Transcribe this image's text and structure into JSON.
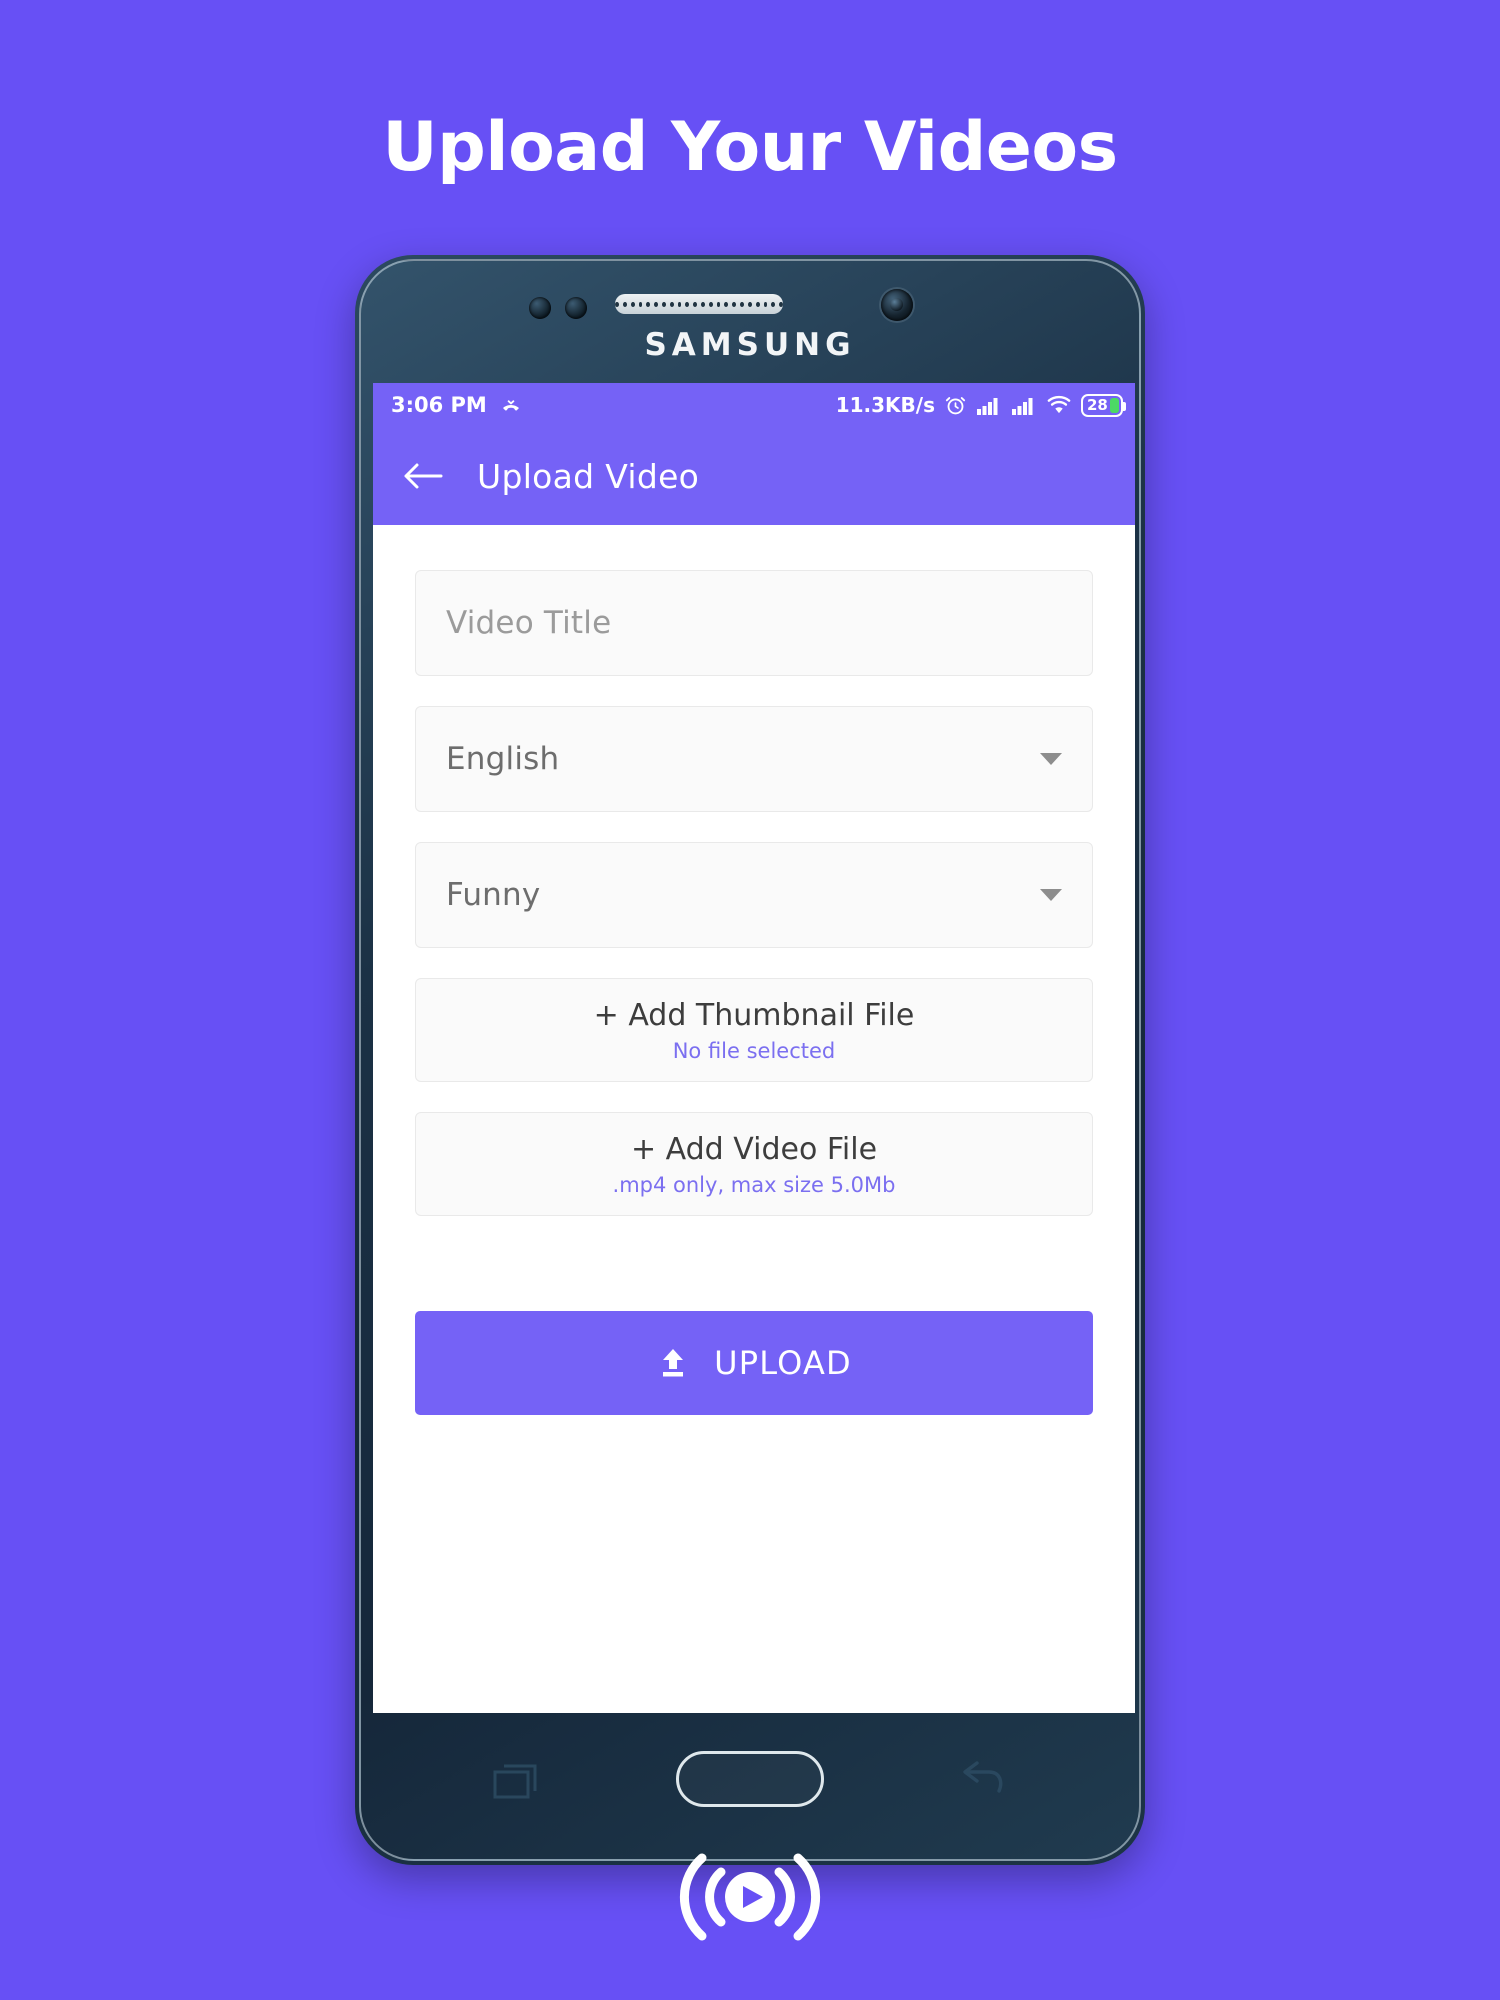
{
  "page": {
    "headline": "Upload Your Videos",
    "background_color": "#6750f5",
    "accent_color": "#7562f6"
  },
  "phone": {
    "brand": "SAMSUNG",
    "earpiece_dots": 22
  },
  "status_bar": {
    "time": "3:06 PM",
    "missed_call_icon": "missed-call-icon",
    "network_speed": "11.3KB/s",
    "alarm_icon": "alarm-clock-icon",
    "signal_1_icon": "signal-bars-icon",
    "signal_2_icon": "signal-bars-icon",
    "wifi_icon": "wifi-icon",
    "battery_level": "28"
  },
  "app_bar": {
    "back_icon": "back-arrow-icon",
    "title": "Upload Video"
  },
  "form": {
    "title_input": {
      "placeholder": "Video Title",
      "value": ""
    },
    "language_select": {
      "value": "English",
      "caret_icon": "chevron-down-icon"
    },
    "category_select": {
      "value": "Funny",
      "caret_icon": "chevron-down-icon"
    },
    "thumbnail_file": {
      "title": "+ Add Thumbnail File",
      "subtitle": "No file selected"
    },
    "video_file": {
      "title": "+ Add Video File",
      "subtitle": ".mp4 only, max size 5.0Mb"
    },
    "upload_button": {
      "label": "UPLOAD",
      "icon": "upload-icon"
    }
  },
  "nav_bar": {
    "recents_icon": "recents-icon",
    "home_icon": "home-button",
    "back_icon": "back-icon"
  },
  "footer": {
    "logo_icon": "live-broadcast-play-icon"
  }
}
